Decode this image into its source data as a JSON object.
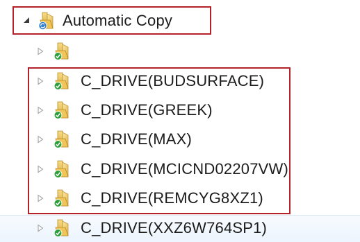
{
  "tree": {
    "root": {
      "label": "Automatic Copy",
      "expanded": true
    },
    "children": [
      {
        "label": ""
      },
      {
        "label": "C_DRIVE(BUDSURFACE)"
      },
      {
        "label": "C_DRIVE(GREEK)"
      },
      {
        "label": "C_DRIVE(MAX)"
      },
      {
        "label": "C_DRIVE(MCICND02207VW)"
      },
      {
        "label": "C_DRIVE(REMCYG8XZ1)"
      },
      {
        "label": "C_DRIVE(XXZ6W764SP1)"
      }
    ]
  },
  "icons": {
    "root_folder": "folder-sync-icon",
    "child_folder": "folder-check-icon",
    "collapsed": "triangle-right-icon",
    "expanded": "triangle-down-icon"
  },
  "colors": {
    "highlight_border": "#b3212b",
    "folder": "#e8c15a",
    "check": "#2e9e3c",
    "sync": "#2f7fd0",
    "expander": "#9a9a9a"
  }
}
